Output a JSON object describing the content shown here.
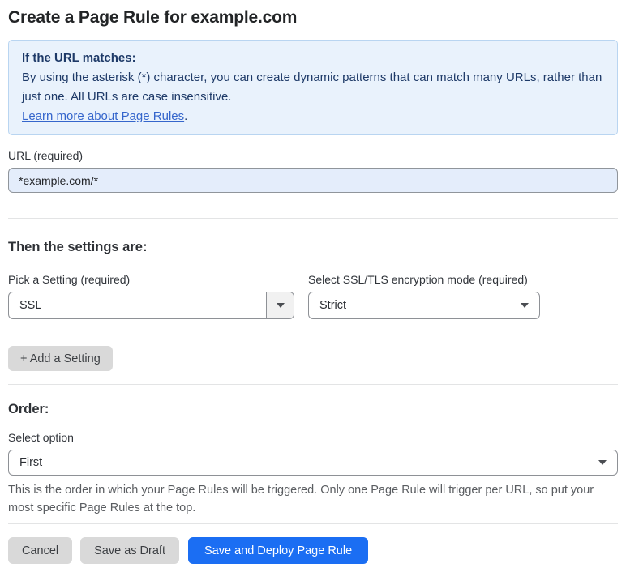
{
  "page": {
    "title": "Create a Page Rule for example.com"
  },
  "info_box": {
    "heading": "If the URL matches:",
    "body": "By using the asterisk (*) character, you can create dynamic patterns that can match many URLs, rather than just one. All URLs are case insensitive.",
    "link": "Learn more about Page Rules",
    "link_suffix": "."
  },
  "url_field": {
    "label": "URL (required)",
    "value": "*example.com/*"
  },
  "settings_section": {
    "heading": "Then the settings are:",
    "setting_select": {
      "label": "Pick a Setting (required)",
      "value": "SSL"
    },
    "mode_select": {
      "label": "Select SSL/TLS encryption mode (required)",
      "value": "Strict"
    },
    "add_setting_label": "+ Add a Setting"
  },
  "order_section": {
    "heading": "Order:",
    "select_label": "Select option",
    "value": "First",
    "help_text": "This is the order in which your Page Rules will be triggered. Only one Page Rule will trigger per URL, so put your most specific Page Rules at the top."
  },
  "footer": {
    "cancel_label": "Cancel",
    "save_draft_label": "Save as Draft",
    "deploy_label": "Save and Deploy Page Rule"
  },
  "colors": {
    "accent_blue": "#1b6ef3",
    "info_background": "#e9f2fc",
    "info_border": "#b9d5f1",
    "info_text": "#1e3a68",
    "link_blue": "#3566cc",
    "url_input_background": "#e4edfb",
    "gray_button": "#d9d9d9"
  }
}
